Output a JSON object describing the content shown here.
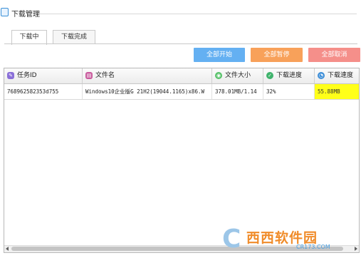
{
  "window": {
    "title": "下载管理"
  },
  "tabs": [
    {
      "label": "下载中",
      "active": true
    },
    {
      "label": "下载完成",
      "active": false
    }
  ],
  "toolbar": {
    "start_all": "全部开始",
    "pause_all": "全部暂停",
    "cancel_all": "全部取消",
    "colors": {
      "start": "#64b0f2",
      "pause": "#f8a15a",
      "cancel": "#f58f8a"
    }
  },
  "table": {
    "columns": [
      {
        "label": "任务ID",
        "icon": "task-id-icon",
        "color": "#8a6fd8"
      },
      {
        "label": "文件名",
        "icon": "file-icon",
        "color": "#c95c9e"
      },
      {
        "label": "文件大小",
        "icon": "size-icon",
        "color": "#58c26a"
      },
      {
        "label": "下载进度",
        "icon": "progress-icon",
        "color": "#3fb36c"
      },
      {
        "label": "下载速度",
        "icon": "speed-icon",
        "color": "#3f8fd8"
      }
    ],
    "rows": [
      {
        "task_id": "768962582353d755",
        "file_name": "Windows10企业版G 21H2(19044.1165)x86.W",
        "file_size": "378.01MB/1.14",
        "progress": "32%",
        "speed": "55.88MB"
      }
    ],
    "highlight_color": "#ffff19"
  },
  "watermark": {
    "text": "西西软件园",
    "url": "CR173.COM"
  }
}
